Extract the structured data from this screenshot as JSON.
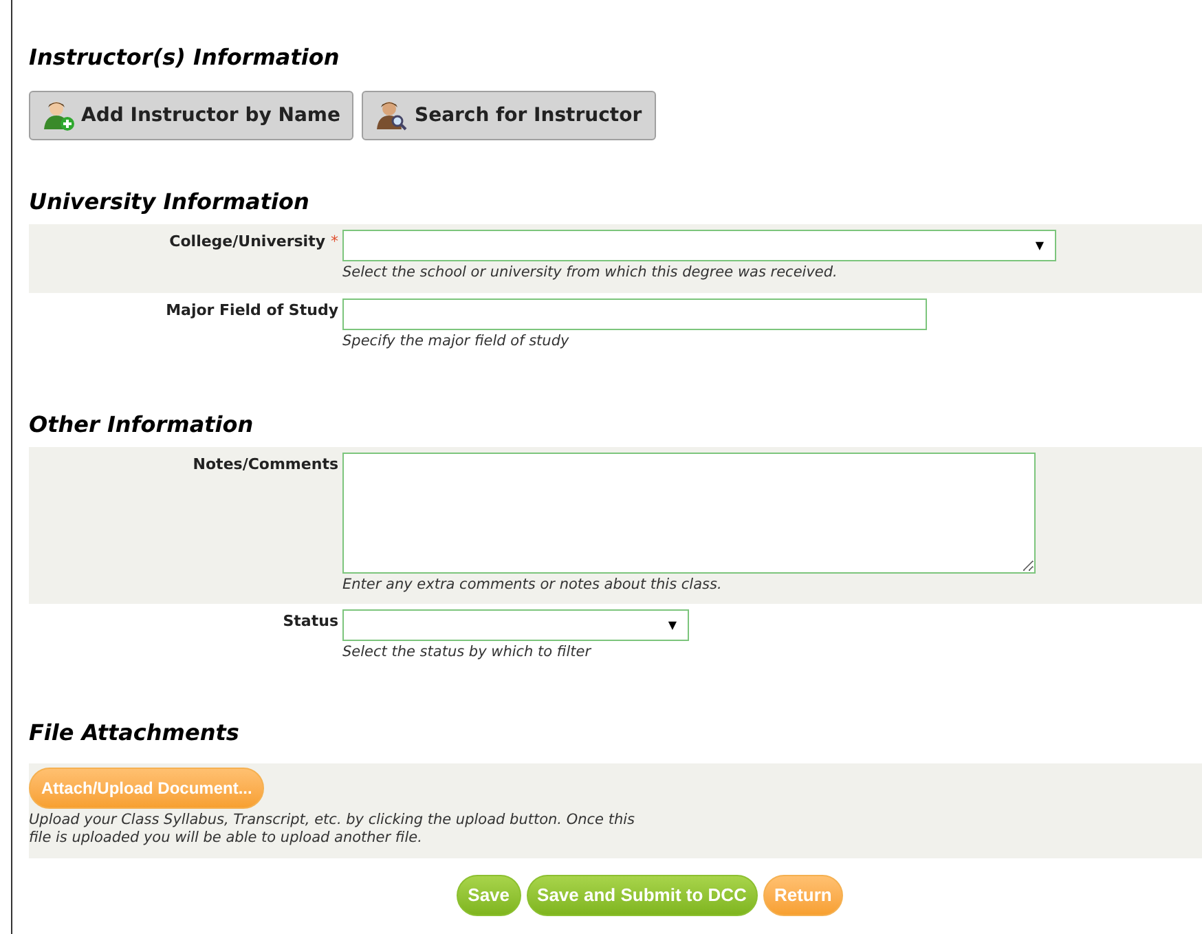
{
  "instructors": {
    "title": "Instructor(s) Information",
    "buttons": [
      {
        "label": "Add Instructor by Name",
        "kind": "add"
      },
      {
        "label": "Search for Instructor",
        "kind": "search"
      }
    ]
  },
  "sections": [
    {
      "title": "University Information",
      "fields": [
        {
          "label": "College/University",
          "kind": "select",
          "arrow": "▼",
          "required_mark": "*",
          "hint": "Select the school or university from which this degree was received.",
          "shaded": true
        },
        {
          "label": "Major Field of Study",
          "kind": "text",
          "hint": "Specify the major field of study",
          "shaded": false
        }
      ]
    },
    {
      "title": "Other Information",
      "fields": [
        {
          "label": "Notes/Comments",
          "kind": "textarea",
          "hint": "Enter any extra comments or notes about this class.",
          "shaded": true
        },
        {
          "label": "Status",
          "kind": "select-short",
          "arrow": "▼",
          "hint": "Select the status by which to filter",
          "shaded": false
        }
      ]
    }
  ],
  "attachments": {
    "title": "File Attachments",
    "button": "Attach/Upload Document...",
    "note": "Upload your Class Syllabus, Transcript, etc. by clicking the upload button. Once this file is uploaded you will be able to upload another file."
  },
  "actions": [
    {
      "label": "Save",
      "kind": "green"
    },
    {
      "label": "Save and Submit to DCC",
      "kind": "green"
    },
    {
      "label": "Return",
      "kind": "orange"
    }
  ]
}
